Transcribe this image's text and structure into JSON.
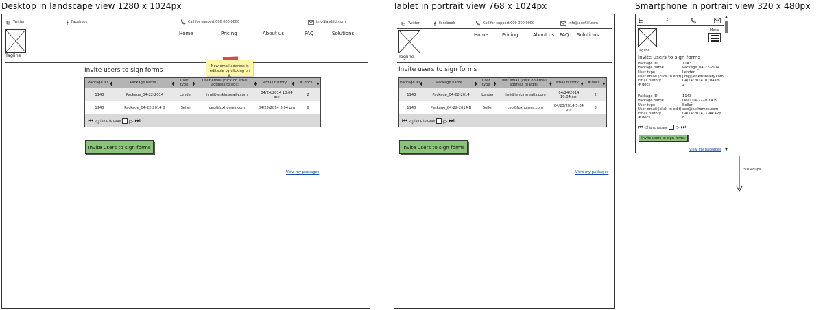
{
  "views": {
    "desktop": "Desktop in landscape view 1280 x 1024px",
    "tablet": "Tablet in portrait view 768 x 1024px",
    "phone": "Smartphone in portrait view 320 x 480px"
  },
  "topbar": {
    "twitter": "Twitter",
    "facebook": "Facebook",
    "support": "Call for support 000 000 0000",
    "email": "info@asdfjkl.com"
  },
  "nav": [
    "Home",
    "Pricing",
    "About us",
    "FAQ",
    "Solutions"
  ],
  "menu_label": "Menu",
  "tagline": "Tagline",
  "heading": "Invite users to sign forms",
  "table": {
    "headers": [
      "Package ID",
      "Package name",
      "User type",
      "User email (click on email address to edit)",
      "email history",
      "# docs"
    ],
    "rows": [
      [
        "1143",
        "Package_04-22-2014",
        "Lender",
        "jimj@jenkinsrealty.com",
        "04/24/2014 10:04 am",
        "2"
      ],
      [
        "1143",
        "Package_04-22-2014 B",
        "Seller",
        "ceo@luxhomes.com",
        "04/23/2014 5:04 pm",
        "8"
      ]
    ]
  },
  "pager_label": "Jump to page",
  "note": "New email address is editable by clicking on it.",
  "invite_button": "Invite users to sign forms",
  "view_packages": "View my packages",
  "mobile": {
    "labels": [
      "Package ID",
      "Package name",
      "User type",
      "User email (click to edit)",
      "Email history",
      "# docs"
    ],
    "records": [
      [
        "1143",
        "Package_04-22-2014",
        "Lender",
        "jimj@jenkinsrealty.com",
        "04/24/2014 10:04am",
        "2"
      ],
      [
        "1143",
        "Deal_04-22-2014 B",
        "Seller",
        "ceo@luxhomes.com",
        "04/14/2014, 1:44:42p",
        "8"
      ]
    ]
  },
  "height_marker": ">= 480px",
  "colors": {
    "button": "#8cc37b",
    "note": "#fff7a8",
    "tape": "#e04848",
    "link": "#1a4fa3"
  },
  "icons": [
    "twitter-icon",
    "facebook-icon",
    "phone-icon",
    "mail-icon",
    "image-placeholder-icon",
    "sort-icon",
    "first-page-icon",
    "prev-page-icon",
    "next-page-icon",
    "last-page-icon",
    "hamburger-menu-icon"
  ]
}
